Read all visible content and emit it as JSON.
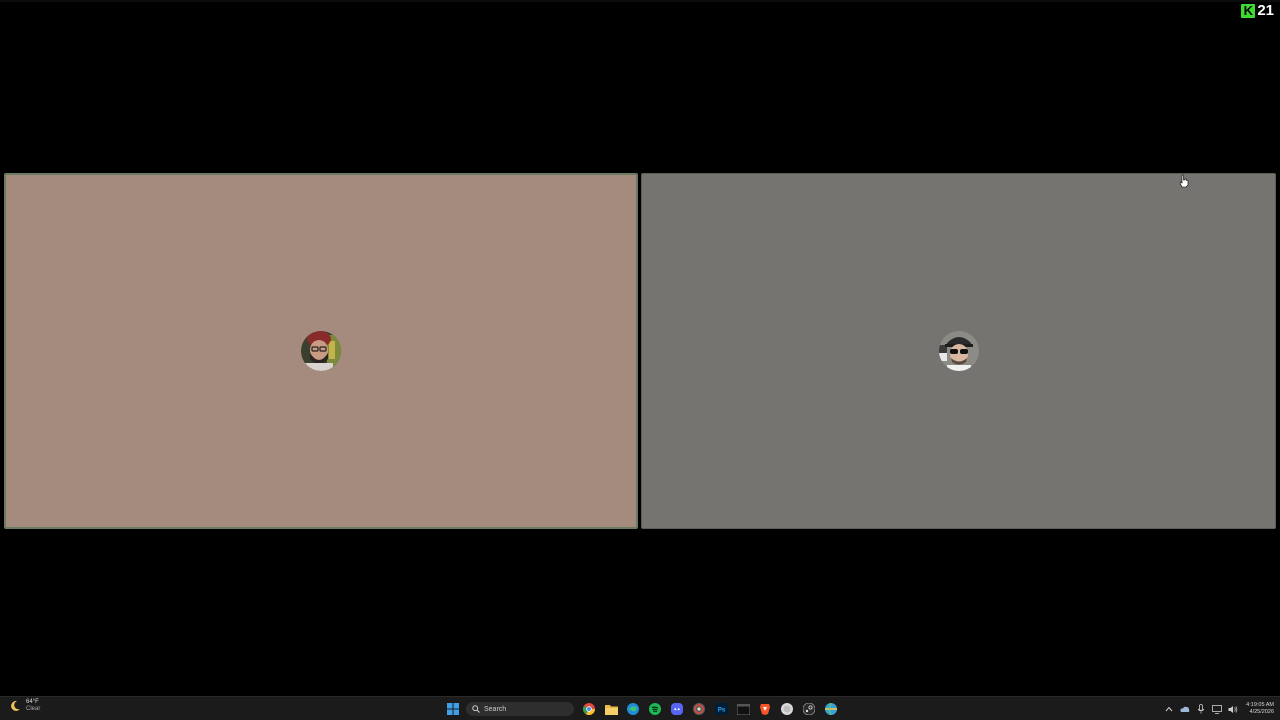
{
  "brand": {
    "logo_letter": "K",
    "number": "21",
    "logo_color": "#3ddc30"
  },
  "participants": [
    {
      "name_visible": "",
      "tile_color": "#a48b7d",
      "border_color": "#6b7a60",
      "avatar_icon": "avatar-bearded-man-icon"
    },
    {
      "name_visible": "",
      "tile_color": "#767470",
      "border_color": "#5e5e59",
      "avatar_icon": "avatar-man-sunglasses-icon"
    }
  ],
  "taskbar": {
    "weather": {
      "temp": "64°F",
      "condition": "Clear",
      "icon": "moon-icon"
    },
    "search": {
      "placeholder": "Search"
    },
    "pinned_apps": [
      {
        "name": "start-menu-icon"
      },
      {
        "name": "chrome-icon"
      },
      {
        "name": "file-explorer-icon"
      },
      {
        "name": "edge-icon"
      },
      {
        "name": "spotify-icon"
      },
      {
        "name": "discord-icon"
      },
      {
        "name": "chrome-alt-icon"
      },
      {
        "name": "photoshop-icon"
      },
      {
        "name": "terminal-icon"
      },
      {
        "name": "brave-icon"
      },
      {
        "name": "obs-icon"
      },
      {
        "name": "steam-icon"
      },
      {
        "name": "app-globe-icon"
      }
    ],
    "photoshop_label": "Ps",
    "clock": {
      "time": "4:19:05 AM",
      "date": "4/25/2026"
    }
  }
}
